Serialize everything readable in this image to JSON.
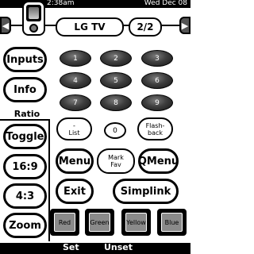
{
  "status_bar": {
    "time": "2:38am",
    "date": "Wed Dec 08"
  },
  "nav": {
    "prev_glyph": "◀",
    "next_glyph": "▶",
    "device": "LG TV",
    "page": "2/2"
  },
  "left_column": {
    "inputs": "Inputs",
    "info": "Info",
    "ratio_label": "Ratio",
    "toggle": "Toggle",
    "r169": "16:9",
    "r43": "4:3",
    "zoom": "Zoom"
  },
  "keypad": [
    "1",
    "2",
    "3",
    "4",
    "5",
    "6",
    "7",
    "8",
    "9"
  ],
  "keypad_row4": {
    "list": "-\nList",
    "zero": "0",
    "flashback": "Flash-\nback"
  },
  "actions": {
    "menu": "Menu",
    "mark_fav": "Mark\nFav",
    "qmenu": "QMenu",
    "exit": "Exit",
    "simplink": "Simplink"
  },
  "color_buttons": [
    "Red",
    "Green",
    "Yellow",
    "Blue"
  ],
  "softkeys": {
    "left": "Set",
    "right": "Unset"
  }
}
